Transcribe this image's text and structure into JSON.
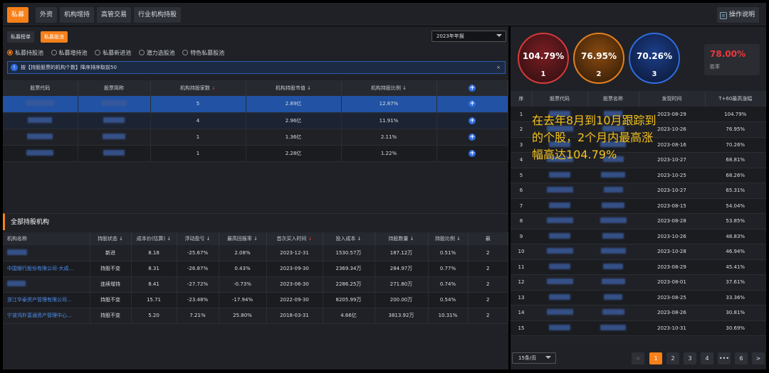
{
  "top_tabs": [
    "私募",
    "外资",
    "机构增持",
    "高管交易",
    "行业机构持股"
  ],
  "help_label": "操作说明",
  "sub_tabs": [
    "私募榜单",
    "私募股池"
  ],
  "year_select": "2023年年报",
  "pool_radios": [
    "私募持股池",
    "私募增持池",
    "私募新进池",
    "潜力选股池",
    "特色私募股池"
  ],
  "info_text": "按【持股股票的机构个数】降序排序取前50",
  "holdings_table": {
    "headers": [
      "股票代码",
      "股票简称",
      "机构持股家数",
      "机构持股市值",
      "机构持股比例"
    ],
    "rows": [
      {
        "count": "5",
        "value": "2.89亿",
        "ratio": "12.87%"
      },
      {
        "count": "4",
        "value": "2.96亿",
        "ratio": "11.91%"
      },
      {
        "count": "1",
        "value": "1.36亿",
        "ratio": "2.11%"
      },
      {
        "count": "1",
        "value": "2.28亿",
        "ratio": "1.22%"
      }
    ]
  },
  "section2_title": "全部持股机构",
  "institutions_table": {
    "headers": [
      "机构名称",
      "持股状态",
      "成本价(估算)",
      "浮动盈亏",
      "最高回报率",
      "首次买入时间",
      "投入成本",
      "持股数量",
      "持股比例",
      "最"
    ],
    "rows": [
      {
        "name": "",
        "status": "新进",
        "cost": "8.18",
        "float": "-25.67%",
        "maxret": "2.08%",
        "first": "2023-12-31",
        "invest": "1530.57万",
        "shares": "187.12万",
        "pct": "0.51%",
        "last": "2"
      },
      {
        "name": "中国银行股份有限公司-大成...",
        "status": "持股不变",
        "cost": "8.31",
        "float": "-26.87%",
        "maxret": "0.43%",
        "first": "2023-09-30",
        "invest": "2369.34万",
        "shares": "284.97万",
        "pct": "0.77%",
        "last": "2"
      },
      {
        "name": "",
        "status": "连续增持",
        "cost": "8.41",
        "float": "-27.72%",
        "maxret": "-0.73%",
        "first": "2023-06-30",
        "invest": "2286.25万",
        "shares": "271.80万",
        "pct": "0.74%",
        "last": "2"
      },
      {
        "name": "浙江华泰资产管理有限公司...",
        "status": "持股不变",
        "cost": "15.71",
        "float": "-23.48%",
        "maxret": "-17.94%",
        "first": "2022-09-30",
        "invest": "8205.99万",
        "shares": "200.00万",
        "pct": "0.54%",
        "last": "2"
      },
      {
        "name": "宁波鸿朴富通资产管理中心...",
        "status": "持股不变",
        "cost": "5.20",
        "float": "7.21%",
        "maxret": "25.80%",
        "first": "2018-03-31",
        "invest": "4.66亿",
        "shares": "3813.92万",
        "pct": "10.31%",
        "last": "2"
      }
    ]
  },
  "top3": [
    {
      "pct": "104.79%",
      "rank": "1",
      "color": "#d63a3a"
    },
    {
      "pct": "76.95%",
      "rank": "2",
      "color": "#e2801f"
    },
    {
      "pct": "70.26%",
      "rank": "3",
      "color": "#2f6de0"
    }
  ],
  "win_rate": {
    "value": "78.00%",
    "label": "胜率"
  },
  "ranking_table": {
    "headers": [
      "序",
      "股票代码",
      "股票名称",
      "发现时间",
      "T+60最高涨幅"
    ],
    "rows": [
      {
        "n": "1",
        "date": "2023-08-29",
        "gain": "104.79%"
      },
      {
        "n": "2",
        "date": "2023-10-26",
        "gain": "76.95%"
      },
      {
        "n": "3",
        "date": "2023-08-16",
        "gain": "70.26%"
      },
      {
        "n": "4",
        "date": "2023-10-27",
        "gain": "68.81%"
      },
      {
        "n": "5",
        "date": "2023-10-25",
        "gain": "68.26%"
      },
      {
        "n": "6",
        "date": "2023-10-27",
        "gain": "65.31%"
      },
      {
        "n": "7",
        "date": "2023-08-15",
        "gain": "54.04%"
      },
      {
        "n": "8",
        "date": "2023-08-28",
        "gain": "53.85%"
      },
      {
        "n": "9",
        "date": "2023-10-26",
        "gain": "48.83%"
      },
      {
        "n": "10",
        "date": "2023-10-28",
        "gain": "46.94%"
      },
      {
        "n": "11",
        "date": "2023-08-29",
        "gain": "45.41%"
      },
      {
        "n": "12",
        "date": "2023-08-01",
        "gain": "37.61%"
      },
      {
        "n": "13",
        "date": "2023-08-25",
        "gain": "33.36%"
      },
      {
        "n": "14",
        "date": "2023-08-26",
        "gain": "30.81%"
      },
      {
        "n": "15",
        "date": "2023-10-31",
        "gain": "30.69%"
      }
    ]
  },
  "overlay_text": "在去年8月到10月跟踪到的个股，2个月内最高涨幅高达104.79%",
  "pager": {
    "page_size": "15条/页",
    "pages": [
      "<",
      "1",
      "2",
      "3",
      "4",
      "•••",
      "6",
      ">"
    ]
  }
}
